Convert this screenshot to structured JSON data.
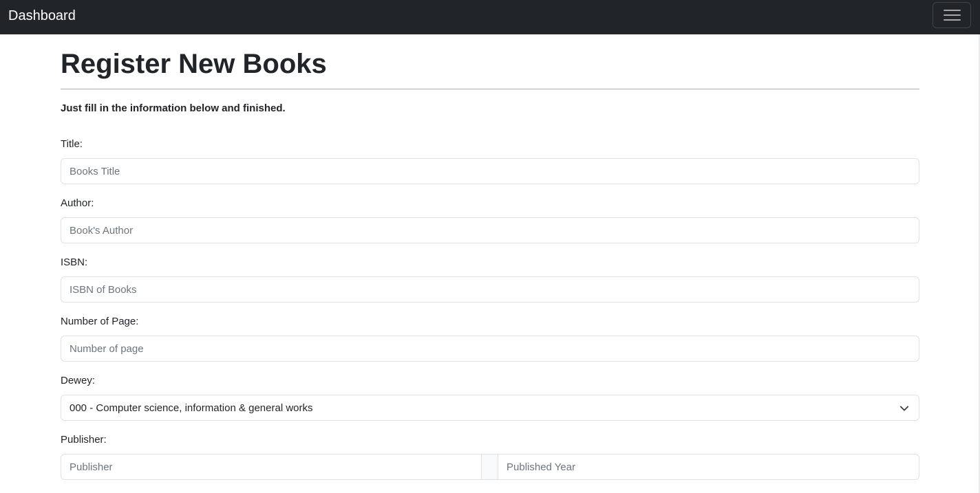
{
  "navbar": {
    "brand": "Dashboard",
    "toggle_icon": "hamburger-menu-icon"
  },
  "page": {
    "title": "Register New Books",
    "lead": "Just fill in the information below and finished."
  },
  "form": {
    "title": {
      "label": "Title:",
      "placeholder": "Books Title",
      "value": ""
    },
    "author": {
      "label": "Author:",
      "placeholder": "Book's Author",
      "value": ""
    },
    "isbn": {
      "label": "ISBN:",
      "placeholder": "ISBN of Books",
      "value": ""
    },
    "pages": {
      "label": "Number of Page:",
      "placeholder": "Number of page",
      "value": ""
    },
    "dewey": {
      "label": "Dewey:",
      "selected": "000 - Computer science, information & general works",
      "icon": "chevron-down-icon"
    },
    "publisher": {
      "label": "Publisher:",
      "publisher_placeholder": "Publisher",
      "year_placeholder": "Published Year"
    }
  },
  "colors": {
    "navbar_bg": "#212529",
    "border": "#dee2e6",
    "placeholder": "#6c757d"
  }
}
